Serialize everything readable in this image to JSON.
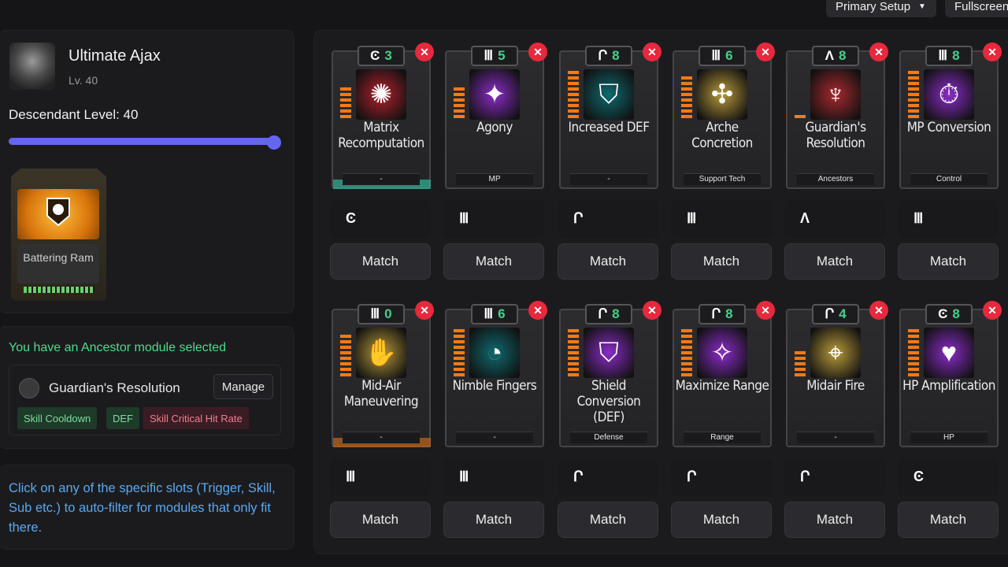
{
  "top_buttons": {
    "setup": "Primary Setup",
    "fullscreen": "Fullscreen"
  },
  "descendant": {
    "name": "Ultimate Ajax",
    "level": "Lv. 40",
    "descendant_level_label": "Descendant Level: 40",
    "slider_value": 1.0
  },
  "ultimate_module": {
    "name": "Battering Ram"
  },
  "ancestor": {
    "notice": "You have an Ancestor module selected",
    "module_name": "Guardian's Resolution",
    "manage_label": "Manage",
    "tags": [
      {
        "label": "Skill Cooldown",
        "color": "#1e3a28",
        "text": "#7fdca0"
      },
      {
        "label": "DEF",
        "color": "#1e3a28",
        "text": "#7fdca0"
      },
      {
        "label": "Skill Critical Hit Rate",
        "color": "#3a1c24",
        "text": "#f07e92"
      }
    ]
  },
  "info_text": "Click on any of the specific slots (Trigger, Skill, Sub etc.) to auto-filter for modules that only fit there.",
  "modules": [
    {
      "name": "Matrix Recomputation",
      "type": "-",
      "socket": "C",
      "capacity": "3",
      "bars": 6,
      "color": "#b4202c",
      "icon": "matrix-icon",
      "foot": "#2fb89a"
    },
    {
      "name": "Agony",
      "type": "MP",
      "socket": "M",
      "capacity": "5",
      "bars": 6,
      "color": "#8a2cc8",
      "icon": "agony-icon",
      "foot": "none"
    },
    {
      "name": "Increased DEF",
      "type": "-",
      "socket": "F",
      "capacity": "8",
      "bars": 9,
      "color": "#0e6a70",
      "icon": "shield-up-icon",
      "foot": "none"
    },
    {
      "name": "Arche Concretion",
      "type": "Support Tech",
      "socket": "M",
      "capacity": "6",
      "bars": 8,
      "color": "#b89a3a",
      "icon": "arche-icon",
      "foot": "none"
    },
    {
      "name": "Guardian's Resolution",
      "type": "Ancestors",
      "socket": "A",
      "capacity": "8",
      "bars": 1,
      "color": "#a8282e",
      "icon": "guardian-icon",
      "foot": "none"
    },
    {
      "name": "MP Conversion",
      "type": "Control",
      "socket": "M",
      "capacity": "8",
      "bars": 9,
      "color": "#8a2cc8",
      "icon": "mp-conversion-icon",
      "foot": "none"
    },
    {
      "name": "Mid-Air Maneuvering",
      "type": "-",
      "socket": "M",
      "capacity": "0",
      "bars": 8,
      "color": "#b89a3a",
      "icon": "mid-air-icon",
      "foot": "#c4661a"
    },
    {
      "name": "Nimble Fingers",
      "type": "-",
      "socket": "M",
      "capacity": "6",
      "bars": 9,
      "color": "#0e6a70",
      "icon": "nimble-icon",
      "foot": "none"
    },
    {
      "name": "Shield Conversion (DEF)",
      "type": "Defense",
      "socket": "F",
      "capacity": "8",
      "bars": 9,
      "color": "#8a2cc8",
      "icon": "shield-conv-icon",
      "foot": "none"
    },
    {
      "name": "Maximize Range",
      "type": "Range",
      "socket": "F",
      "capacity": "8",
      "bars": 9,
      "color": "#8a2cc8",
      "icon": "range-icon",
      "foot": "none"
    },
    {
      "name": "Midair Fire",
      "type": "-",
      "socket": "F",
      "capacity": "4",
      "bars": 5,
      "color": "#b89a3a",
      "icon": "crosshair-icon",
      "foot": "none"
    },
    {
      "name": "HP Amplification",
      "type": "HP",
      "socket": "C",
      "capacity": "8",
      "bars": 9,
      "color": "#8a2cc8",
      "icon": "heart-icon",
      "foot": "none"
    }
  ],
  "slots": [
    {
      "socket": "C",
      "match": "Match"
    },
    {
      "socket": "M",
      "match": "Match"
    },
    {
      "socket": "F",
      "match": "Match"
    },
    {
      "socket": "M",
      "match": "Match"
    },
    {
      "socket": "A",
      "match": "Match"
    },
    {
      "socket": "M",
      "match": "Match"
    },
    {
      "socket": "M",
      "match": "Match"
    },
    {
      "socket": "M",
      "match": "Match"
    },
    {
      "socket": "F",
      "match": "Match"
    },
    {
      "socket": "F",
      "match": "Match"
    },
    {
      "socket": "F",
      "match": "Match"
    },
    {
      "socket": "C",
      "match": "Match"
    }
  ]
}
